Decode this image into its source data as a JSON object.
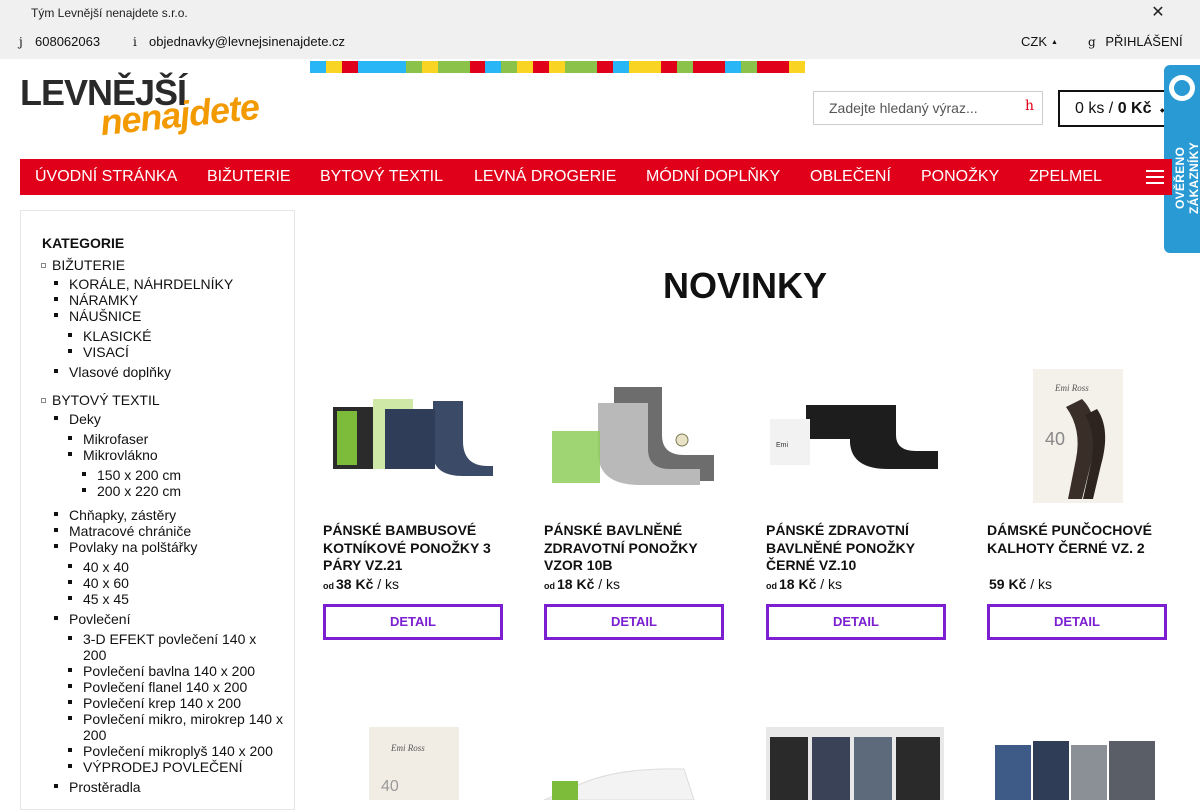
{
  "topbar": {
    "team": "Tým Levnější nenajdete s.r.o.",
    "phone_icon": "j",
    "phone": "608062063",
    "email_icon": "i",
    "email": "objednavky@levnejsinenajdete.cz",
    "currency": "CZK",
    "login_icon": "g",
    "login": "PŘIHLÁŠENÍ"
  },
  "logo": {
    "line1": "LEVNĚJŠÍ",
    "line2": "nenajdete"
  },
  "stripe_colors": [
    "#29b6f6",
    "#f9d423",
    "#e0001a",
    "#29b6f6",
    "#29b6f6",
    "#29b6f6",
    "#8bc34a",
    "#f9d423",
    "#8bc34a",
    "#8bc34a",
    "#e0001a",
    "#29b6f6",
    "#8bc34a",
    "#f9d423",
    "#e0001a",
    "#f9d423",
    "#8bc34a",
    "#8bc34a",
    "#e0001a",
    "#29b6f6",
    "#f9d423",
    "#f9d423",
    "#e0001a",
    "#8bc34a",
    "#e0001a",
    "#e0001a",
    "#29b6f6",
    "#8bc34a",
    "#e0001a",
    "#e0001a",
    "#f9d423"
  ],
  "search": {
    "placeholder": "Zadejte hledaný výraz...",
    "button_icon": "h"
  },
  "cart": {
    "count": "0 ks",
    "separator": " / ",
    "total": "0 Kč"
  },
  "badge": {
    "text": "OVĚŘENO ZÁKAZNÍKY"
  },
  "nav": {
    "items": [
      "ÚVODNÍ STRÁNKA",
      "BIŽUTERIE",
      "BYTOVÝ TEXTIL",
      "LEVNÁ DROGERIE",
      "MÓDNÍ DOPLŇKY",
      "OBLEČENÍ",
      "PONOŽKY",
      "ZPELMEL"
    ]
  },
  "sidebar": {
    "title": "KATEGORIE",
    "items": [
      "BIŽUTERIE",
      "KORÁLE, NÁHRDELNÍKY",
      "NÁRAMKY",
      "NÁUŠNICE",
      "KLASICKÉ",
      "VISACÍ",
      "Vlasové doplňky",
      "BYTOVÝ TEXTIL",
      "Deky",
      "Mikrofaser",
      "Mikrovlákno",
      "150 x 200 cm",
      "200 x 220 cm",
      "Chňapky, zástěry",
      "Matracové chrániče",
      "Povlaky na polštářky",
      "40 x 40",
      "40 x 60",
      "45 x 45",
      "Povlečení",
      "3-D EFEKT povlečení 140 x 200",
      "Povlečení bavlna 140 x 200",
      "Povlečení flanel 140 x 200",
      "Povlečení krep 140 x 200",
      "Povlečení mikro, mirokrep 140 x 200",
      "Povlečení mikroplyš 140 x 200",
      "VÝPRODEJ POVLEČENÍ",
      "Prostěradla"
    ]
  },
  "main": {
    "heading": "NOVINKY",
    "detail_label": "DETAIL",
    "products": [
      {
        "name": "PÁNSKÉ BAMBUSOVÉ KOTNÍKOVÉ PONOŽKY 3 PÁRY VZ.21",
        "od": "od",
        "price": "38 Kč",
        "unit": " / ks"
      },
      {
        "name": "PÁNSKÉ BAVLNĚNÉ ZDRAVOTNÍ PONOŽKY VZOR 10B",
        "od": "od",
        "price": "18 Kč",
        "unit": " / ks"
      },
      {
        "name": "PÁNSKÉ ZDRAVOTNÍ BAVLNĚNÉ PONOŽKY ČERNÉ VZ.10",
        "od": "od",
        "price": "18 Kč",
        "unit": " / ks"
      },
      {
        "name": "DÁMSKÉ PUNČOCHOVÉ KALHOTY ČERNÉ VZ. 2",
        "od": "",
        "price": "59 Kč",
        "unit": " / ks"
      },
      {
        "name": "",
        "od": "",
        "price": "",
        "unit": ""
      },
      {
        "name": "",
        "od": "",
        "price": "",
        "unit": ""
      },
      {
        "name": "",
        "od": "",
        "price": "",
        "unit": ""
      },
      {
        "name": "",
        "od": "",
        "price": "",
        "unit": ""
      }
    ],
    "product_images_text": {
      "brand": "Emi Ross",
      "size_mark": "40"
    }
  }
}
